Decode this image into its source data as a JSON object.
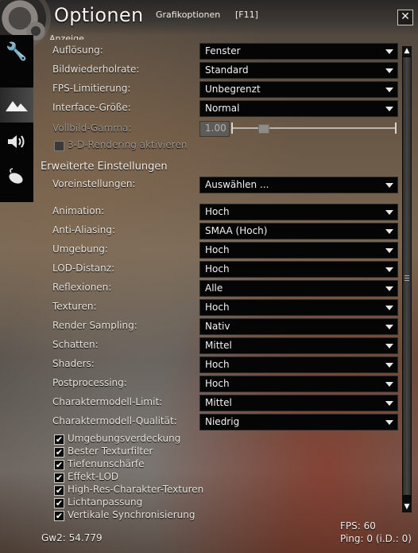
{
  "window": {
    "title": "Optionen",
    "subtitle": "Grafikoptionen",
    "hotkey": "[F11]",
    "close_glyph": "✕"
  },
  "tabs": [
    {
      "icon": "wrench-icon",
      "glyph": "🔧"
    },
    {
      "icon": "mountains-icon",
      "glyph": "▲"
    },
    {
      "icon": "speaker-icon",
      "glyph": "🔊"
    },
    {
      "icon": "mouse-icon",
      "glyph": "🖱"
    }
  ],
  "section_cut_label": "Anzeige",
  "display": [
    {
      "label": "Auflösung:",
      "value": "Fenster"
    },
    {
      "label": "Bildwiederholrate:",
      "value": "Standard"
    },
    {
      "label": "FPS-Limitierung:",
      "value": "Unbegrenzt"
    },
    {
      "label": "Interface-Größe:",
      "value": "Normal"
    }
  ],
  "gamma": {
    "label": "Vollbild-Gamma:",
    "value": "1.00",
    "slider_fraction": 0.2
  },
  "rendering_3d": {
    "label": "3-D-Rendering aktivieren",
    "checked": false
  },
  "advanced_title": "Erweiterte Einstellungen",
  "preset": {
    "label": "Voreinstellungen:",
    "value": "Auswählen ..."
  },
  "advanced": [
    {
      "label": "Animation:",
      "value": "Hoch"
    },
    {
      "label": "Anti-Aliasing:",
      "value": "SMAA (Hoch)"
    },
    {
      "label": "Umgebung:",
      "value": "Hoch"
    },
    {
      "label": "LOD-Distanz:",
      "value": "Hoch"
    },
    {
      "label": "Reflexionen:",
      "value": "Alle"
    },
    {
      "label": "Texturen:",
      "value": "Hoch"
    },
    {
      "label": "Render Sampling:",
      "value": "Nativ"
    },
    {
      "label": "Schatten:",
      "value": "Mittel"
    },
    {
      "label": "Shaders:",
      "value": "Hoch"
    },
    {
      "label": "Postprocessing:",
      "value": "Hoch"
    },
    {
      "label": "Charaktermodell-Limit:",
      "value": "Mittel"
    },
    {
      "label": "Charaktermodell-Qualität:",
      "value": "Niedrig"
    }
  ],
  "checkboxes": [
    {
      "label": "Umgebungsverdeckung",
      "checked": true
    },
    {
      "label": "Bester Texturfilter",
      "checked": true
    },
    {
      "label": "Tiefenunschärfe",
      "checked": true
    },
    {
      "label": "Effekt-LOD",
      "checked": true
    },
    {
      "label": "High-Res-Charakter-Texturen",
      "checked": true
    },
    {
      "label": "Lichtanpassung",
      "checked": true
    },
    {
      "label": "Vertikale Synchronisierung",
      "checked": true
    }
  ],
  "footer": {
    "build": "Gw2: 54.779",
    "fps": "FPS: 60",
    "ping": "Ping: 0 (i.D.: 0)"
  }
}
